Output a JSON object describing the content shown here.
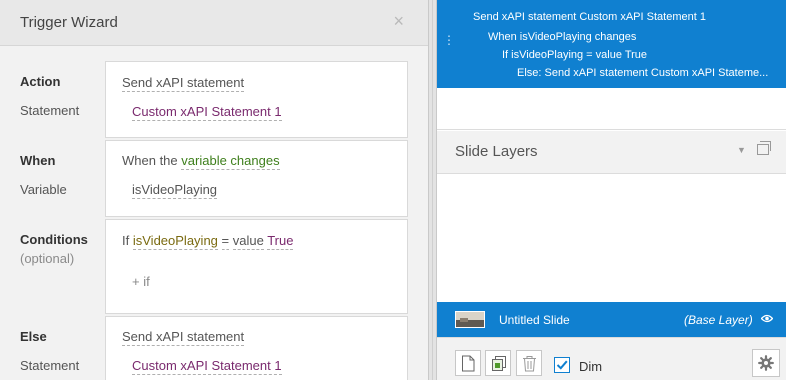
{
  "wizard": {
    "title": "Trigger Wizard",
    "close": "×",
    "action": {
      "label": "Action",
      "sub_label": "Statement",
      "value": "Send xAPI statement",
      "statement": "Custom xAPI Statement 1"
    },
    "when": {
      "label": "When",
      "sub_label": "Variable",
      "prefix": "When the",
      "event": "variable changes",
      "variable": "isVideoPlaying"
    },
    "conditions": {
      "label": "Conditions",
      "optional": "(optional)",
      "if_word": "If",
      "variable": "isVideoPlaying",
      "operator": "=",
      "value_word": "value",
      "value": "True",
      "add_if": "+ if"
    },
    "else": {
      "label": "Else",
      "sub_label": "Statement",
      "value": "Send xAPI statement",
      "statement": "Custom xAPI Statement 1"
    }
  },
  "triggers": {
    "lines": [
      "Send xAPI statement Custom xAPI Statement 1",
      "When isVideoPlaying changes",
      "If isVideoPlaying = value True",
      "Else: Send xAPI statement Custom xAPI Stateme..."
    ]
  },
  "layers": {
    "title": "Slide Layers",
    "base_layer": {
      "name": "Untitled Slide",
      "tag": "(Base Layer)"
    },
    "dim_label": "Dim",
    "dim_checked": true
  },
  "colors": {
    "selection_blue": "#1080d0",
    "link_purple": "#7a2a6e",
    "event_green": "#3e7f1c",
    "variable_olive": "#7a6a10"
  },
  "icons": [
    "close-icon",
    "drag-handle-icon",
    "menu-chevron-icon",
    "popout-icon",
    "eye-icon",
    "new-layer-icon",
    "duplicate-layer-icon",
    "delete-layer-icon",
    "checkbox-icon",
    "gear-icon"
  ]
}
